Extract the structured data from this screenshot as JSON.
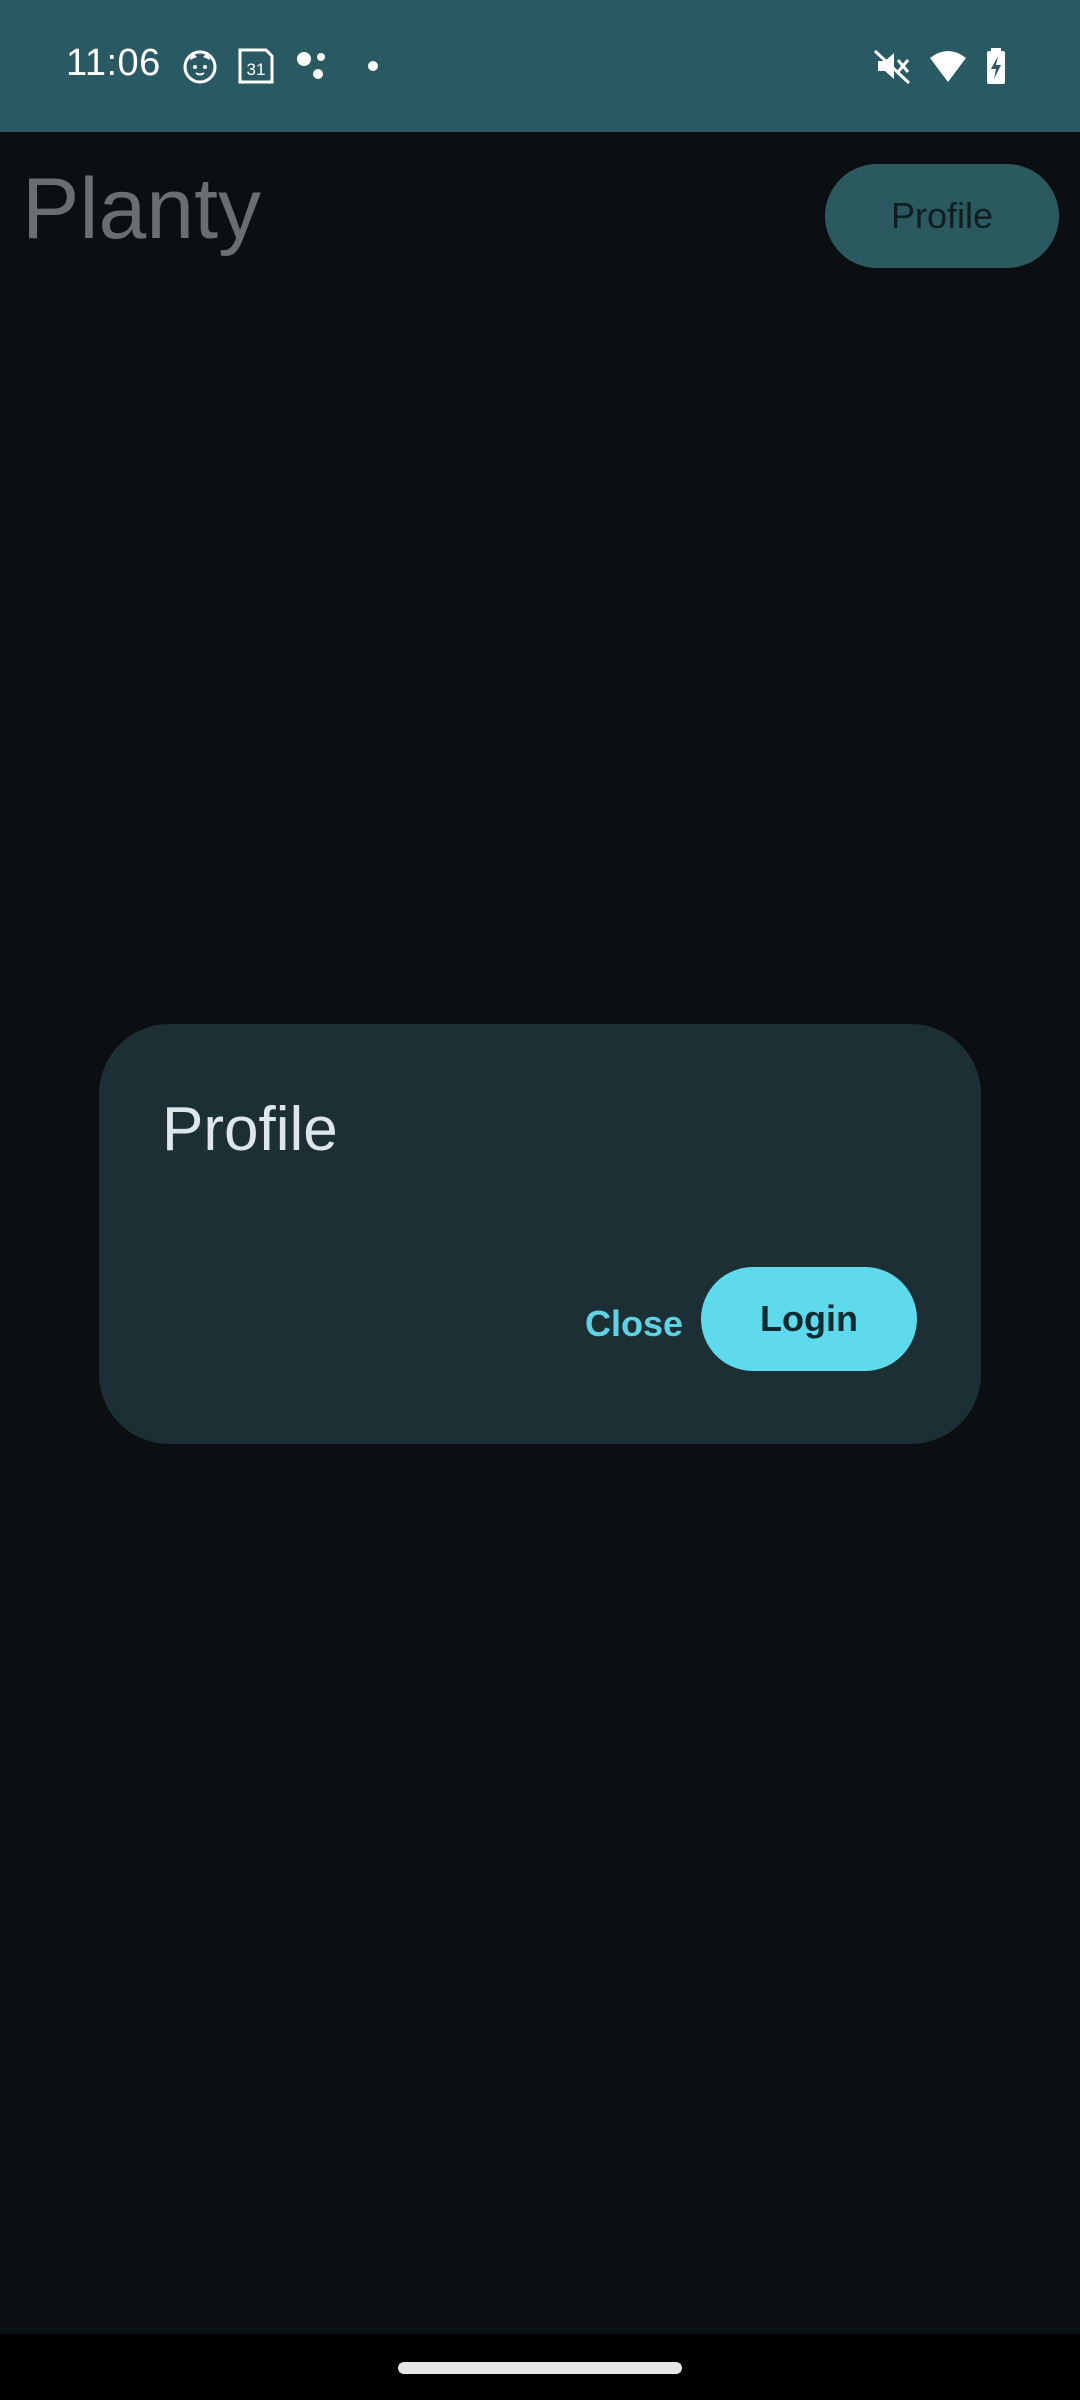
{
  "status_bar": {
    "time": "11:06",
    "calendar_day": "31",
    "icons": [
      "cat-face-icon",
      "calendar-icon",
      "assistant-dots-icon",
      "notification-dot-icon",
      "mute-icon",
      "wifi-icon",
      "battery-charging-icon"
    ]
  },
  "app": {
    "title": "Planty",
    "profile_button_label": "Profile"
  },
  "dialog": {
    "title": "Profile",
    "close_label": "Close",
    "login_label": "Login"
  },
  "colors": {
    "status_bar_bg": "#295a63",
    "background": "#0b0f11",
    "dialog_bg": "#1c2f34",
    "accent": "#5fd9ec"
  }
}
